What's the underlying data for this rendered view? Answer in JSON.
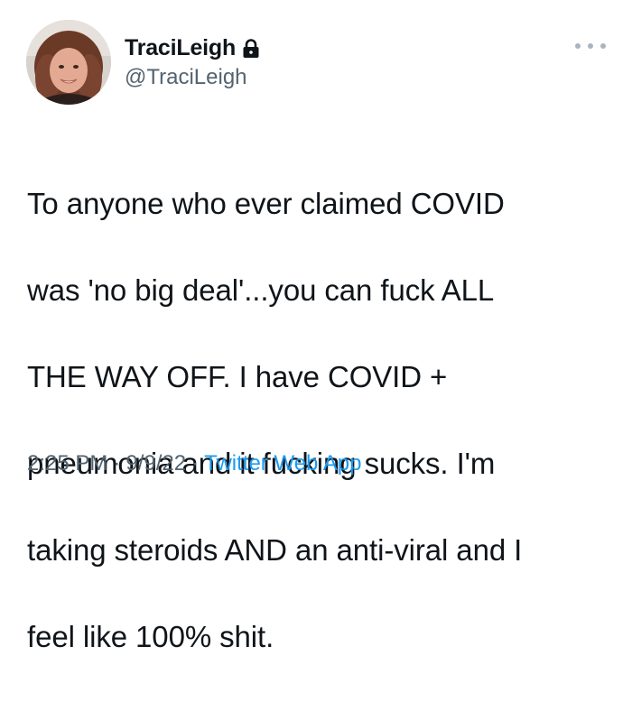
{
  "author": {
    "display_name": "TraciLeigh",
    "handle": "@TraciLeigh",
    "protected_icon": "lock-icon"
  },
  "tweet": {
    "text_lines": [
      "To anyone who ever claimed COVID",
      "was 'no big deal'...you can fuck ALL",
      "THE WAY OFF. I have COVID +",
      "pneumonia and it fucking sucks. I'm",
      "taking steroids AND an anti-viral and I",
      "feel like 100% shit."
    ]
  },
  "meta": {
    "time": "2:25 PM",
    "separator": "·",
    "date": "9/9/22",
    "source": "Twitter Web App"
  },
  "actions": {
    "more_icon": "more-horizontal-icon"
  },
  "colors": {
    "text_primary": "#0f1419",
    "text_secondary": "#536471",
    "link": "#1d9bf0"
  }
}
